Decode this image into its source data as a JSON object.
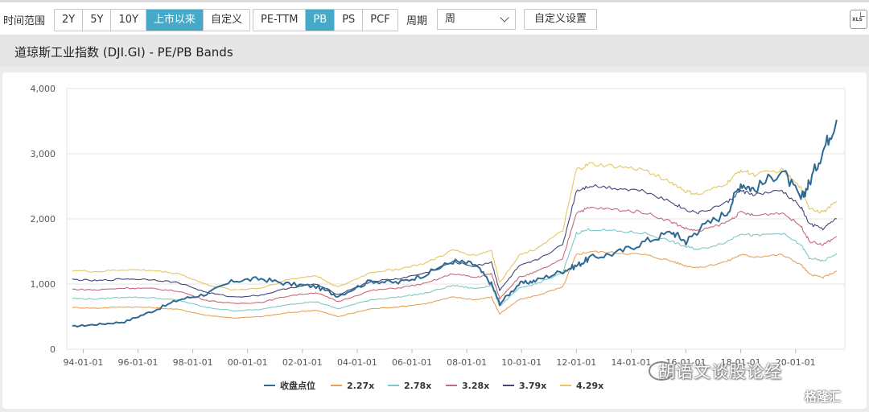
{
  "toolbar": {
    "range_label": "时间范围",
    "range_options": [
      "2Y",
      "5Y",
      "10Y",
      "上市以来",
      "自定义"
    ],
    "range_active": "上市以来",
    "metric_options": [
      "PE-TTM",
      "PB",
      "PS",
      "PCF"
    ],
    "metric_active": "PB",
    "period_label": "周期",
    "period_value": "周",
    "custom_settings_label": "自定义设置",
    "export_icon": "xls-export-icon",
    "export_text": "XLS"
  },
  "chart_title": "道琼斯工业指数 (DJI.GI) - PE/PB Bands",
  "watermark": {
    "text": "胡语文谈股论经",
    "text2": "格隆汇"
  },
  "chart_data": {
    "type": "line",
    "x_ticks": [
      "94-01-01",
      "96-01-01",
      "98-01-01",
      "00-01-01",
      "02-01-01",
      "04-01-01",
      "06-01-01",
      "08-01-01",
      "10-01-01",
      "12-01-01",
      "14-01-01",
      "16-01-01",
      "18-01-01",
      "20-01-01"
    ],
    "y_ticks": [
      "0",
      "1,000",
      "2,000",
      "3,000",
      "4,000"
    ],
    "ylim": [
      0,
      4000
    ],
    "grid": true,
    "legend_position": "bottom",
    "x": [
      1993.6,
      1994.5,
      1995.5,
      1996.5,
      1997.5,
      1998.5,
      1999.5,
      2000.5,
      2001.5,
      2002.5,
      2003.3,
      2004.5,
      2005.5,
      2006.5,
      2007.5,
      2008.3,
      2008.9,
      2009.2,
      2009.9,
      2010.5,
      2011.5,
      2012.0,
      2012.5,
      2013.5,
      2014.5,
      2015.5,
      2016.0,
      2016.5,
      2017.5,
      2018.0,
      2018.5,
      2019.5,
      2020.2,
      2020.5,
      2021.0,
      2021.5
    ],
    "series": [
      {
        "name": "收盘点位",
        "color": "#2e6a92",
        "values": [
          350,
          380,
          420,
          580,
          760,
          850,
          1050,
          1080,
          1000,
          960,
          820,
          1050,
          1020,
          1150,
          1350,
          1300,
          1000,
          700,
          1000,
          1050,
          1200,
          1280,
          1400,
          1480,
          1650,
          1800,
          1650,
          1850,
          2100,
          2550,
          2450,
          2750,
          2300,
          2550,
          3050,
          3520
        ]
      },
      {
        "name": "2.27x",
        "color": "#e8a258",
        "values": [
          640,
          630,
          650,
          640,
          610,
          520,
          480,
          500,
          560,
          600,
          500,
          620,
          650,
          700,
          800,
          760,
          800,
          540,
          760,
          820,
          950,
          1450,
          1500,
          1480,
          1450,
          1350,
          1280,
          1250,
          1350,
          1450,
          1420,
          1450,
          1300,
          1150,
          1100,
          1200
        ]
      },
      {
        "name": "2.78x",
        "color": "#7ec8c8",
        "values": [
          780,
          770,
          800,
          790,
          750,
          640,
          590,
          610,
          690,
          730,
          620,
          760,
          800,
          860,
          980,
          930,
          980,
          660,
          930,
          1000,
          1170,
          1780,
          1840,
          1810,
          1780,
          1650,
          1570,
          1530,
          1650,
          1780,
          1740,
          1780,
          1600,
          1400,
          1350,
          1470
        ]
      },
      {
        "name": "3.28x",
        "color": "#c9687a",
        "values": [
          920,
          910,
          940,
          930,
          890,
          750,
          700,
          720,
          820,
          870,
          730,
          900,
          940,
          1010,
          1160,
          1100,
          1160,
          780,
          1100,
          1180,
          1380,
          2100,
          2170,
          2140,
          2100,
          1950,
          1850,
          1810,
          1950,
          2100,
          2050,
          2100,
          1890,
          1660,
          1600,
          1730
        ]
      },
      {
        "name": "3.79x",
        "color": "#44457a",
        "values": [
          1070,
          1050,
          1080,
          1070,
          1020,
          870,
          800,
          830,
          940,
          1000,
          840,
          1040,
          1080,
          1170,
          1340,
          1270,
          1340,
          900,
          1270,
          1360,
          1600,
          2430,
          2510,
          2470,
          2430,
          2250,
          2140,
          2090,
          2250,
          2430,
          2370,
          2430,
          2180,
          1920,
          1850,
          2000
        ]
      },
      {
        "name": "4.29x",
        "color": "#e3c860",
        "values": [
          1210,
          1190,
          1220,
          1210,
          1160,
          990,
          910,
          940,
          1070,
          1130,
          950,
          1180,
          1230,
          1320,
          1520,
          1440,
          1520,
          1020,
          1440,
          1540,
          1810,
          2750,
          2840,
          2800,
          2750,
          2550,
          2420,
          2370,
          2550,
          2750,
          2680,
          2750,
          2470,
          2170,
          2100,
          2270
        ]
      }
    ]
  }
}
